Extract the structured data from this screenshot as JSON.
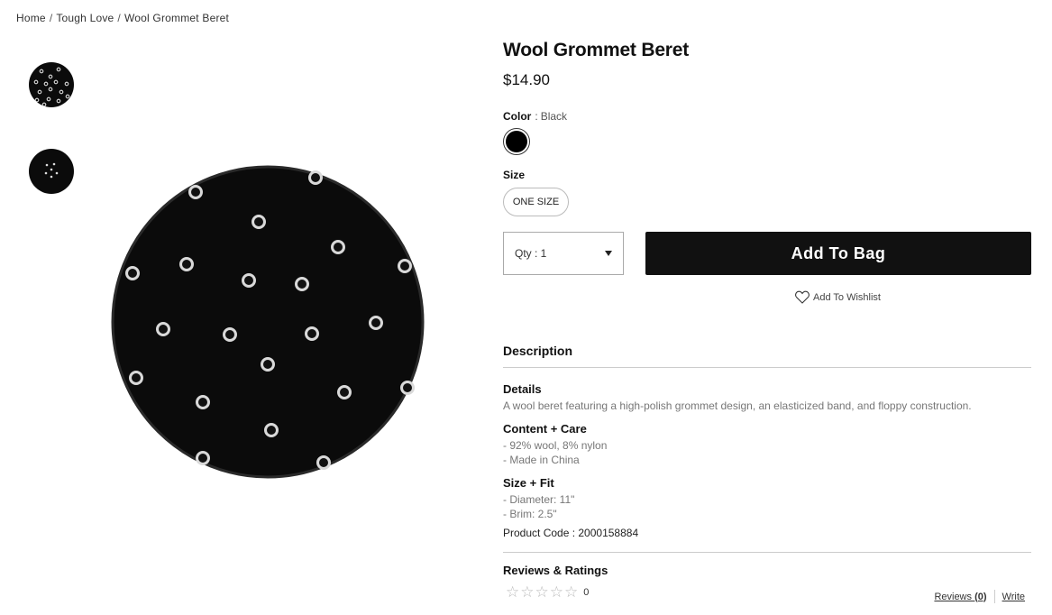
{
  "breadcrumb": {
    "items": [
      "Home",
      "Tough Love",
      "Wool Grommet Beret"
    ],
    "separator": "/"
  },
  "product": {
    "title": "Wool Grommet Beret",
    "price": "$14.90"
  },
  "color": {
    "label": "Color",
    "separator": ":",
    "value": "Black",
    "swatch_hex": "#000000"
  },
  "size": {
    "label": "Size",
    "option": "ONE SIZE"
  },
  "qty": {
    "label": "Qty : 1"
  },
  "actions": {
    "add_to_bag": "Add To Bag",
    "wishlist": "Add To Wishlist"
  },
  "description": {
    "heading": "Description",
    "details_heading": "Details",
    "details_text": "A wool beret featuring a high-polish grommet design, an elasticized band, and floppy construction.",
    "content_heading": "Content + Care",
    "content_lines": [
      "- 92% wool, 8% nylon",
      "- Made in China"
    ],
    "fit_heading": "Size + Fit",
    "fit_lines": [
      "- Diameter: 11\"",
      "- Brim: 2.5\""
    ],
    "product_code": "Product Code : 2000158884"
  },
  "reviews": {
    "heading": "Reviews & Ratings",
    "count": "0",
    "reviews_label": "Reviews",
    "reviews_count": "(0)",
    "write_label": "Write"
  },
  "colors": {
    "accent": "#111111",
    "beret": "#0b0b0b",
    "grommet": "#d9d9d9"
  }
}
